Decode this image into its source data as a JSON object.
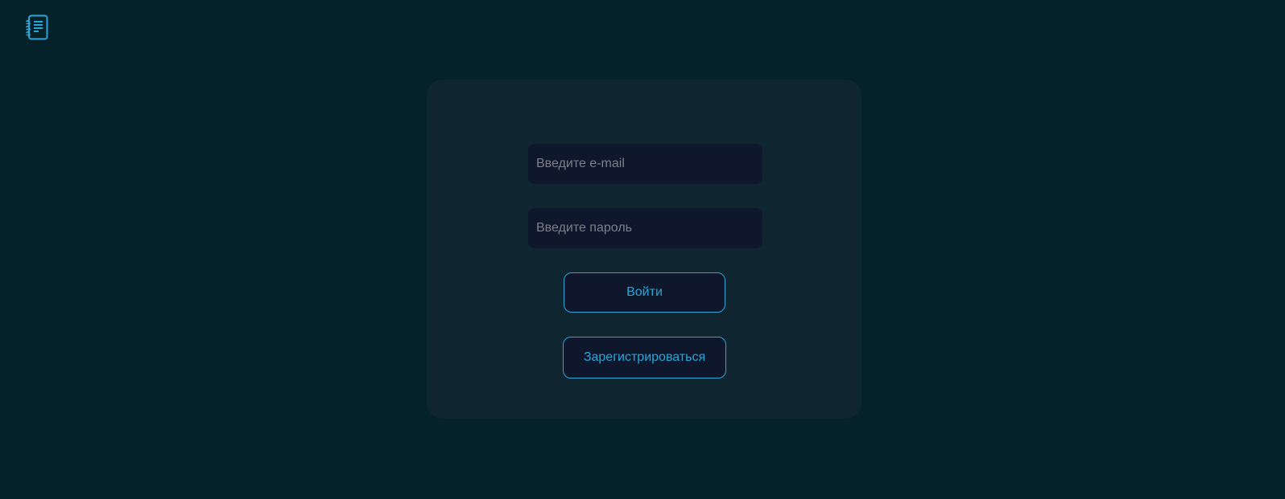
{
  "header": {
    "logo_icon": "notebook-list-icon",
    "accent_color": "#2aa6d8"
  },
  "login_form": {
    "email_placeholder": "Введите e-mail",
    "email_value": "",
    "password_placeholder": "Введите пароль",
    "password_value": "",
    "login_label": "Войти",
    "register_label": "Зарегистрироваться"
  }
}
